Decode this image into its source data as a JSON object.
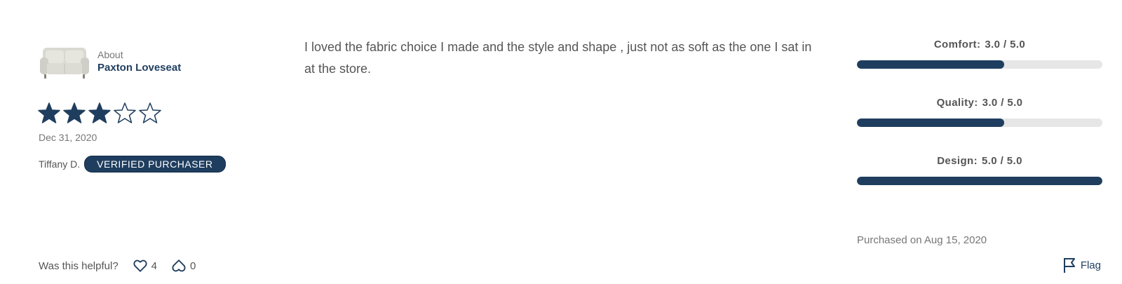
{
  "product": {
    "about_label": "About",
    "name": "Paxton Loveseat"
  },
  "rating": {
    "value": 3,
    "max": 5
  },
  "review": {
    "date": "Dec 31, 2020",
    "author": "Tiffany D.",
    "badge": "VERIFIED PURCHASER",
    "text": "I loved the fabric choice I made and the style and shape , just not as soft as the one I sat in at the store.",
    "purchased": "Purchased on Aug 15, 2020"
  },
  "subratings": [
    {
      "label": "Comfort:",
      "value_text": "3.0 / 5.0",
      "value": 3.0,
      "max": 5.0
    },
    {
      "label": "Quality:",
      "value_text": "3.0 / 5.0",
      "value": 3.0,
      "max": 5.0
    },
    {
      "label": "Design:",
      "value_text": "5.0 / 5.0",
      "value": 5.0,
      "max": 5.0
    }
  ],
  "helpful": {
    "label": "Was this helpful?",
    "likes": "4",
    "dislikes": "0"
  },
  "flag_label": "Flag",
  "colors": {
    "accent": "#1f3e5f",
    "track": "#e6e6e6"
  }
}
